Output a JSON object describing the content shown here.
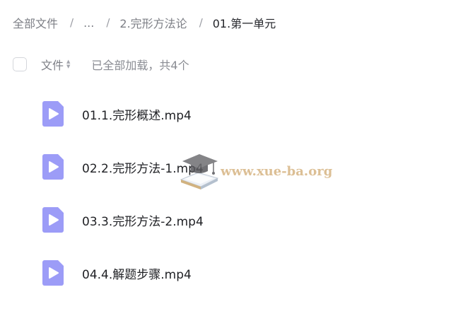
{
  "breadcrumb": {
    "items": [
      "全部文件",
      "...",
      "2.完形方法论",
      "01.第一单元"
    ],
    "separator": "/"
  },
  "list_header": {
    "column_label": "文件",
    "sort_arrows": [
      "▲",
      "▼"
    ],
    "status": "已全部加载，共4个"
  },
  "files": [
    {
      "name": "01.1.完形概述.mp4",
      "icon": "video-file-icon"
    },
    {
      "name": "02.2.完形方法-1.mp4",
      "icon": "video-file-icon"
    },
    {
      "name": "03.3.完形方法-2.mp4",
      "icon": "video-file-icon"
    },
    {
      "name": "04.4.解题步骤.mp4",
      "icon": "video-file-icon"
    }
  ],
  "watermark": {
    "text": "www.xue-ba.org",
    "icon": "graduation-cap-book-icon"
  },
  "colors": {
    "file_icon": "#9c9cf7",
    "file_icon_play": "#ffffff",
    "muted_text": "#7d7f86",
    "primary_text": "#1f2024",
    "watermark_text": "#d9b98a"
  }
}
